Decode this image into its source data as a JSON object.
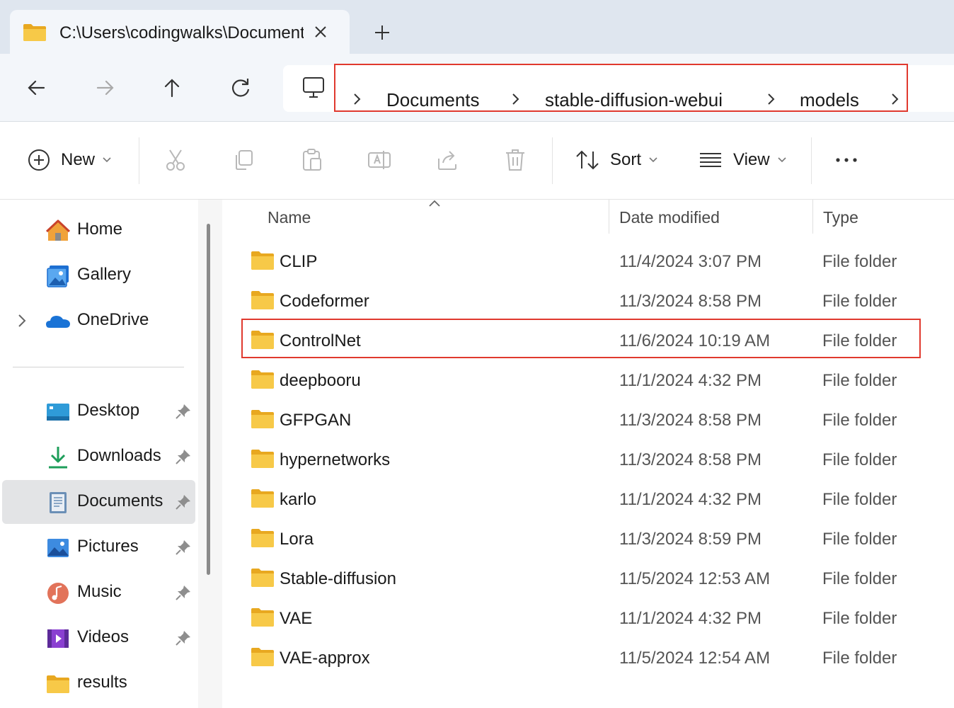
{
  "tab": {
    "title": "C:\\Users\\codingwalks\\Documents\\stable-diffusion-webui\\models",
    "icon": "folder-icon"
  },
  "breadcrumb": [
    "Documents",
    "stable-diffusion-webui",
    "models"
  ],
  "toolbar": {
    "new_label": "New",
    "sort_label": "Sort",
    "view_label": "View",
    "more_label": "•••"
  },
  "sidebar": {
    "top": [
      {
        "label": "Home",
        "icon": "home-icon"
      },
      {
        "label": "Gallery",
        "icon": "gallery-icon"
      },
      {
        "label": "OneDrive",
        "icon": "onedrive-icon"
      }
    ],
    "quick": [
      {
        "label": "Desktop",
        "icon": "desktop-icon",
        "pinned": true
      },
      {
        "label": "Downloads",
        "icon": "downloads-icon",
        "pinned": true
      },
      {
        "label": "Documents",
        "icon": "documents-icon",
        "pinned": true,
        "selected": true
      },
      {
        "label": "Pictures",
        "icon": "pictures-icon",
        "pinned": true
      },
      {
        "label": "Music",
        "icon": "music-icon",
        "pinned": true
      },
      {
        "label": "Videos",
        "icon": "videos-icon",
        "pinned": true
      },
      {
        "label": "results",
        "icon": "folder-icon",
        "pinned": false
      }
    ]
  },
  "columns": {
    "name": "Name",
    "date": "Date modified",
    "type": "Type"
  },
  "files": [
    {
      "name": "CLIP",
      "date": "11/4/2024 3:07 PM",
      "type": "File folder"
    },
    {
      "name": "Codeformer",
      "date": "11/3/2024 8:58 PM",
      "type": "File folder"
    },
    {
      "name": "ControlNet",
      "date": "11/6/2024 10:19 AM",
      "type": "File folder"
    },
    {
      "name": "deepbooru",
      "date": "11/1/2024 4:32 PM",
      "type": "File folder"
    },
    {
      "name": "GFPGAN",
      "date": "11/3/2024 8:58 PM",
      "type": "File folder"
    },
    {
      "name": "hypernetworks",
      "date": "11/3/2024 8:58 PM",
      "type": "File folder"
    },
    {
      "name": "karlo",
      "date": "11/1/2024 4:32 PM",
      "type": "File folder"
    },
    {
      "name": "Lora",
      "date": "11/3/2024 8:59 PM",
      "type": "File folder"
    },
    {
      "name": "Stable-diffusion",
      "date": "11/5/2024 12:53 AM",
      "type": "File folder"
    },
    {
      "name": "VAE",
      "date": "11/1/2024 4:32 PM",
      "type": "File folder"
    },
    {
      "name": "VAE-approx",
      "date": "11/5/2024 12:54 AM",
      "type": "File folder"
    }
  ],
  "colors": {
    "highlight": "#e0392e",
    "folder": "#f5c342",
    "accent": "#0067c0"
  }
}
